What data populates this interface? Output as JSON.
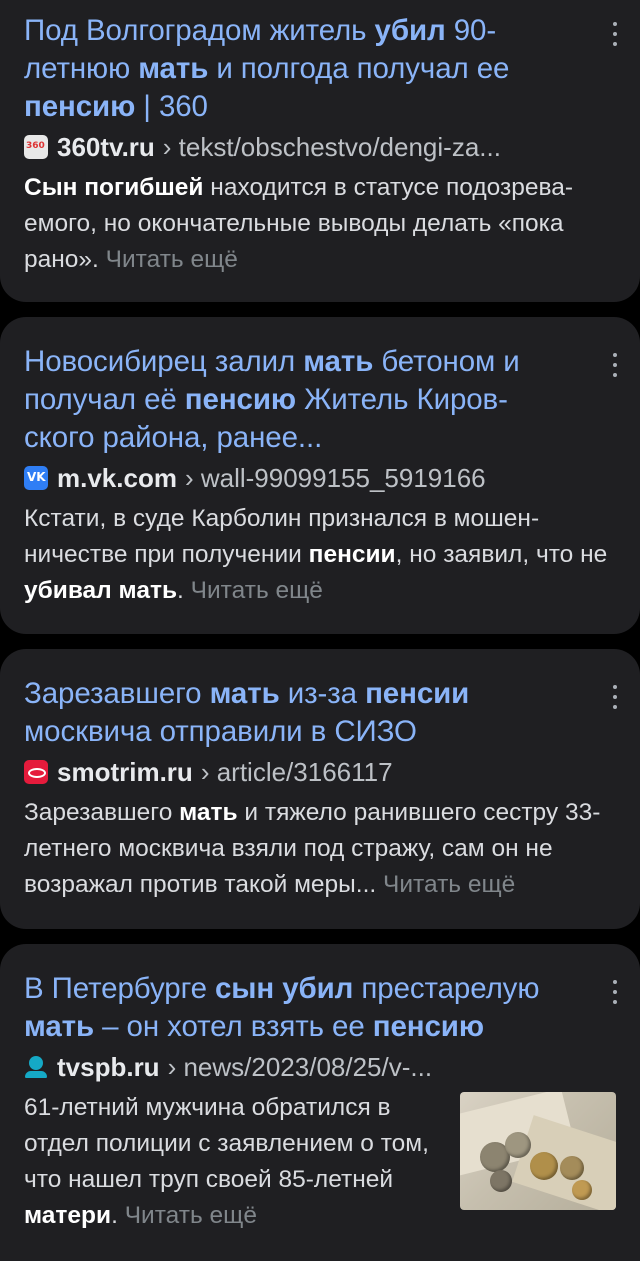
{
  "results": [
    {
      "title_parts": [
        {
          "t": "Под Волгоградом житель ",
          "b": false
        },
        {
          "t": "убил",
          "b": true
        },
        {
          "t": " 90-летнюю ",
          "b": false
        },
        {
          "t": "мать",
          "b": true
        },
        {
          "t": " и полгода получал ее ",
          "b": false
        },
        {
          "t": "пенсию",
          "b": true
        },
        {
          "t": " | 360",
          "b": false
        }
      ],
      "favicon": "360tv-icon",
      "domain": "360tv.ru",
      "path": "› tekst/obschestvo/dengi-za...",
      "snippet_parts": [
        {
          "t": "Сын погибшей",
          "b": true
        },
        {
          "t": " находится в статусе подозрева-емого, но окончательные выводы делать «пока рано». ",
          "b": false
        }
      ],
      "more": "Читать ещё"
    },
    {
      "title_parts": [
        {
          "t": "Новосибирец залил ",
          "b": false
        },
        {
          "t": "мать",
          "b": true
        },
        {
          "t": " бетоном и получал её ",
          "b": false
        },
        {
          "t": "пенсию",
          "b": true
        },
        {
          "t": " Житель Киров-ского района, ранее...",
          "b": false
        }
      ],
      "favicon": "vk-icon",
      "domain": "m.vk.com",
      "path": "› wall-99099155_5919166",
      "snippet_parts": [
        {
          "t": "Кстати, в суде Карболин признался в мошен-ничестве при получении ",
          "b": false
        },
        {
          "t": "пенсии",
          "b": true
        },
        {
          "t": ", но заявил, что не ",
          "b": false
        },
        {
          "t": "убивал мать",
          "b": true
        },
        {
          "t": ". ",
          "b": false
        }
      ],
      "more": "Читать ещё"
    },
    {
      "title_parts": [
        {
          "t": "Зарезавшего ",
          "b": false
        },
        {
          "t": "мать",
          "b": true
        },
        {
          "t": " из-за ",
          "b": false
        },
        {
          "t": "пенсии",
          "b": true
        },
        {
          "t": " москвича отправили в СИЗО",
          "b": false
        }
      ],
      "favicon": "smotrim-icon",
      "domain": "smotrim.ru",
      "path": "› article/3166117",
      "snippet_parts": [
        {
          "t": "Зарезавшего ",
          "b": false
        },
        {
          "t": "мать",
          "b": true
        },
        {
          "t": " и тяжело ранившего сестру 33-летнего москвича взяли под стражу, сам он не возражал против такой меры... ",
          "b": false
        }
      ],
      "more": "Читать ещё"
    },
    {
      "title_parts": [
        {
          "t": "В Петербурге ",
          "b": false
        },
        {
          "t": "сын убил",
          "b": true
        },
        {
          "t": " престарелую ",
          "b": false
        },
        {
          "t": "мать",
          "b": true
        },
        {
          "t": " – он хотел взять ее ",
          "b": false
        },
        {
          "t": "пенсию",
          "b": true
        }
      ],
      "favicon": "tvspb-icon",
      "domain": "tvspb.ru",
      "path": "› news/2023/08/25/v-...",
      "snippet_parts": [
        {
          "t": "61-летний мужчина обратился в отдел полиции с заявлением о том, что нашел труп своей 85-летней ",
          "b": false
        },
        {
          "t": "матери",
          "b": true
        },
        {
          "t": ". ",
          "b": false
        }
      ],
      "more": "Читать ещё",
      "thumbnail": "coins-and-banknotes-image"
    }
  ],
  "more_options_icon": "more-vert-icon"
}
